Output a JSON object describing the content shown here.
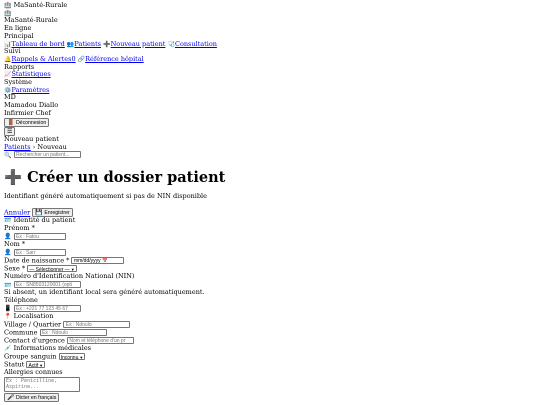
{
  "app": {
    "logo_icon": "hospital-icon",
    "brand_label": "MaSanté-Rurale",
    "brand_title": "MaSanté-Rurale",
    "status": "En ligne"
  },
  "nav": {
    "section_principal": "Principal",
    "dashboard": "Tableau de bord",
    "patients": "Patients",
    "new_patient": "Nouveau patient",
    "consultation": "Consultation",
    "section_suivi": "Suivi",
    "reminders": "Rappels & Alertes",
    "reminders_count": "0",
    "hospital_ref": "Référence hôpital",
    "section_rapports": "Rapports",
    "stats": "Statistiques",
    "section_systeme": "Système",
    "settings": "Paramètres"
  },
  "user": {
    "initials": "MD",
    "name": "Mamadou Diallo",
    "role": "Infirmier Chef",
    "logout": "Déconnexion"
  },
  "topbar": {
    "menu_icon": "hamburger-icon",
    "page_label": "Nouveau patient",
    "breadcrumb_link": "Patients",
    "breadcrumb_sep": "›",
    "breadcrumb_current": "Nouveau",
    "search_placeholder": "Rechercher un patient..."
  },
  "page": {
    "title": "Créer un dossier patient",
    "subtitle": "Identifiant généré automatiquement si pas de NIN disponible",
    "cancel": "Annuler",
    "save": "Enregistrer"
  },
  "identity": {
    "title": "Identité du patient",
    "first_name_label": "Prénom *",
    "first_name_placeholder": "Ex : Fatou",
    "last_name_label": "Nom *",
    "last_name_placeholder": "Ex : Sarr",
    "dob_label": "Date de naissance *",
    "dob_value": "mm/dd/yyyy",
    "sex_label": "Sexe *",
    "sex_value": "— Sélectionner —",
    "nin_label": "Numéro d'Identification National (NIN)",
    "nin_placeholder": "Ex : SN8503120001 (opti",
    "nin_hint": "Si absent, un identifiant local sera généré automatiquement.",
    "phone_label": "Téléphone",
    "phone_placeholder": "Ex : +221 77 123 45 67"
  },
  "location": {
    "title": "Localisation",
    "village_label": "Village / Quartier",
    "village_placeholder": "Ex : Ndoulo",
    "commune_label": "Commune",
    "commune_placeholder": "Ex : Ndoulo",
    "emergency_label": "Contact d'urgence",
    "emergency_placeholder": "Nom et téléphone d'un pr"
  },
  "medical": {
    "title": "Informations médicales",
    "blood_label": "Groupe sanguin",
    "blood_value": "Inconnu",
    "status_label": "Statut",
    "status_value": "Actif",
    "allergies_label": "Allergies connues",
    "allergies_placeholder": "Ex : Pénicilline,\nAspirine...",
    "dictate_button": "Dicter en français"
  }
}
